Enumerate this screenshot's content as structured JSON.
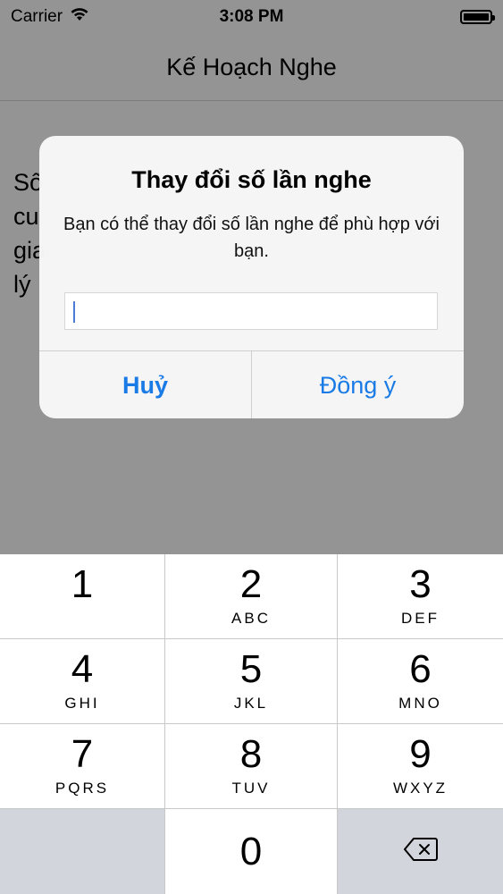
{
  "status_bar": {
    "carrier": "Carrier",
    "time": "3:08 PM"
  },
  "nav": {
    "title": "Kế Hoạch Nghe"
  },
  "content": {
    "partial_text": "Số\ncu\ngia\nlý"
  },
  "alert": {
    "title": "Thay đổi số lần nghe",
    "message": "Bạn có thể thay đổi số lần nghe để phù hợp với bạn.",
    "input_value": "",
    "cancel_label": "Huỷ",
    "confirm_label": "Đồng ý",
    "accent_color": "#1a7be6"
  },
  "keypad": {
    "keys": [
      {
        "num": "1",
        "letters": ""
      },
      {
        "num": "2",
        "letters": "ABC"
      },
      {
        "num": "3",
        "letters": "DEF"
      },
      {
        "num": "4",
        "letters": "GHI"
      },
      {
        "num": "5",
        "letters": "JKL"
      },
      {
        "num": "6",
        "letters": "MNO"
      },
      {
        "num": "7",
        "letters": "PQRS"
      },
      {
        "num": "8",
        "letters": "TUV"
      },
      {
        "num": "9",
        "letters": "WXYZ"
      },
      {
        "num": "0",
        "letters": ""
      }
    ],
    "delete_icon": "backspace-icon"
  }
}
